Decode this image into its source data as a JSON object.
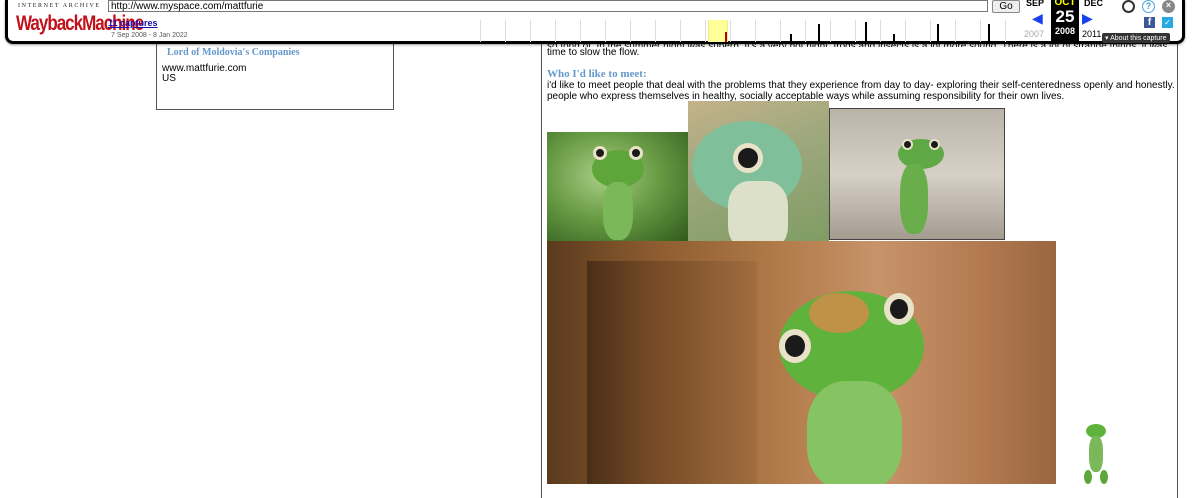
{
  "toolbar": {
    "logo_top": "INTERNET ARCHIVE",
    "logo_main": "WaybackMachine",
    "url_value": "http://www.myspace.com/mattfurie",
    "go_label": "Go",
    "captures_link": "11 captures",
    "capture_range": "7 Sep 2008 - 8 Jan 2022",
    "prev_month": "SEP",
    "current_month": "OCT",
    "current_day": "25",
    "current_year": "2008",
    "next_month": "DEC",
    "prev_year": "2007",
    "next_year": "2011",
    "about_label": "▾ About this capture",
    "accent_color": "#1a41ee"
  },
  "left_panel": {
    "heading": "Lord of Moldovia's Companies",
    "website": "www.mattfurie.com",
    "country": "US"
  },
  "main": {
    "partial_text": "... so fond of. In the summer night was superb. It's a very hot night, frogs and insects is a lot more sound. There is a lot of strange things; it was time to slow the flow.",
    "partial_line1": "so fond of. In the summer night was superb. It's a very hot night, frogs and insects is a lot more sound. There is a lot of strange things, it was",
    "partial_line2": "time to slow the flow.",
    "meet_heading": "Who I'd like to meet:",
    "meet_line1": "i'd like to meet people that deal with the problems that they experience from day to day- exploring their self-centeredness openly and honestly.",
    "meet_line2": "people who express themselves in healthy, socially acceptable ways while assuming responsibility for their own lives."
  }
}
